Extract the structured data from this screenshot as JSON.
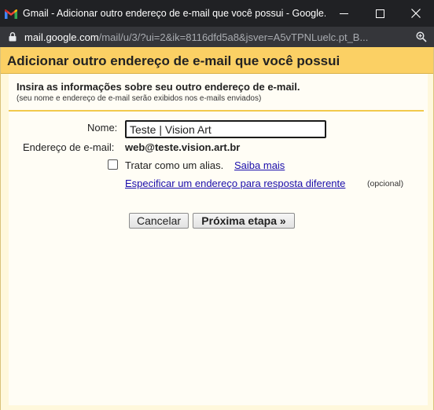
{
  "titlebar": {
    "title": "Gmail - Adicionar outro endereço de e-mail que você possui - Google..."
  },
  "addressbar": {
    "url_host": "mail.google.com",
    "url_path": "/mail/u/3/?ui=2&ik=8116dfd5a8&jsver=A5vTPNLuelc.pt_B..."
  },
  "dialog": {
    "title": "Adicionar outro endereço de e-mail que você possui",
    "intro": "Insira as informações sobre seu outro endereço de e-mail.",
    "intro_note": "(seu nome e endereço de e-mail serão exibidos nos e-mails enviados)"
  },
  "form": {
    "name_label": "Nome:",
    "name_value": "Teste | Vision Art",
    "email_label": "Endereço de e-mail:",
    "email_value": "web@teste.vision.art.br",
    "alias_label": "Tratar como um alias.",
    "alias_checked": false,
    "saiba_mais": "Saiba mais",
    "reply_link": "Especificar um endereço para resposta diferente",
    "opcional": "(opcional)"
  },
  "buttons": {
    "cancel": "Cancelar",
    "next": "Próxima etapa »"
  },
  "colors": {
    "titlebar_bg": "#202124",
    "addressbar_bg": "#35363a",
    "header_bg": "#fbd064",
    "frame_bg": "#fff8dc",
    "link": "#1a0dab"
  }
}
